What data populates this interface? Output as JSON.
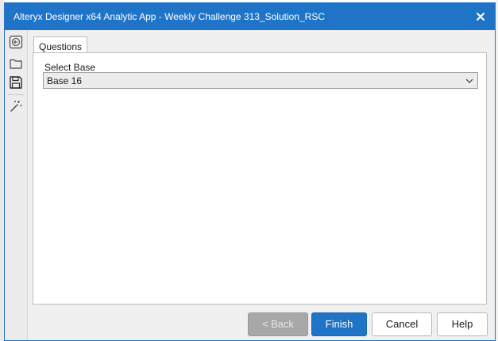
{
  "window": {
    "title": "Alteryx Designer x64 Analytic App - Weekly Challenge 313_Solution_RSC",
    "close_icon": "close-icon",
    "accent_color": "#1f74c8"
  },
  "toolbar": {
    "items": [
      {
        "icon": "back-arrow-icon"
      },
      {
        "icon": "folder-open-icon"
      },
      {
        "icon": "save-icon"
      },
      {
        "icon": "magic-wand-icon"
      }
    ]
  },
  "tabs": [
    {
      "label": "Questions",
      "selected": true
    }
  ],
  "form": {
    "select_base": {
      "label": "Select Base",
      "value": "Base 16"
    }
  },
  "buttons": {
    "back": {
      "label": "< Back",
      "enabled": false
    },
    "finish": {
      "label": "Finish"
    },
    "cancel": {
      "label": "Cancel"
    },
    "help": {
      "label": "Help"
    }
  }
}
